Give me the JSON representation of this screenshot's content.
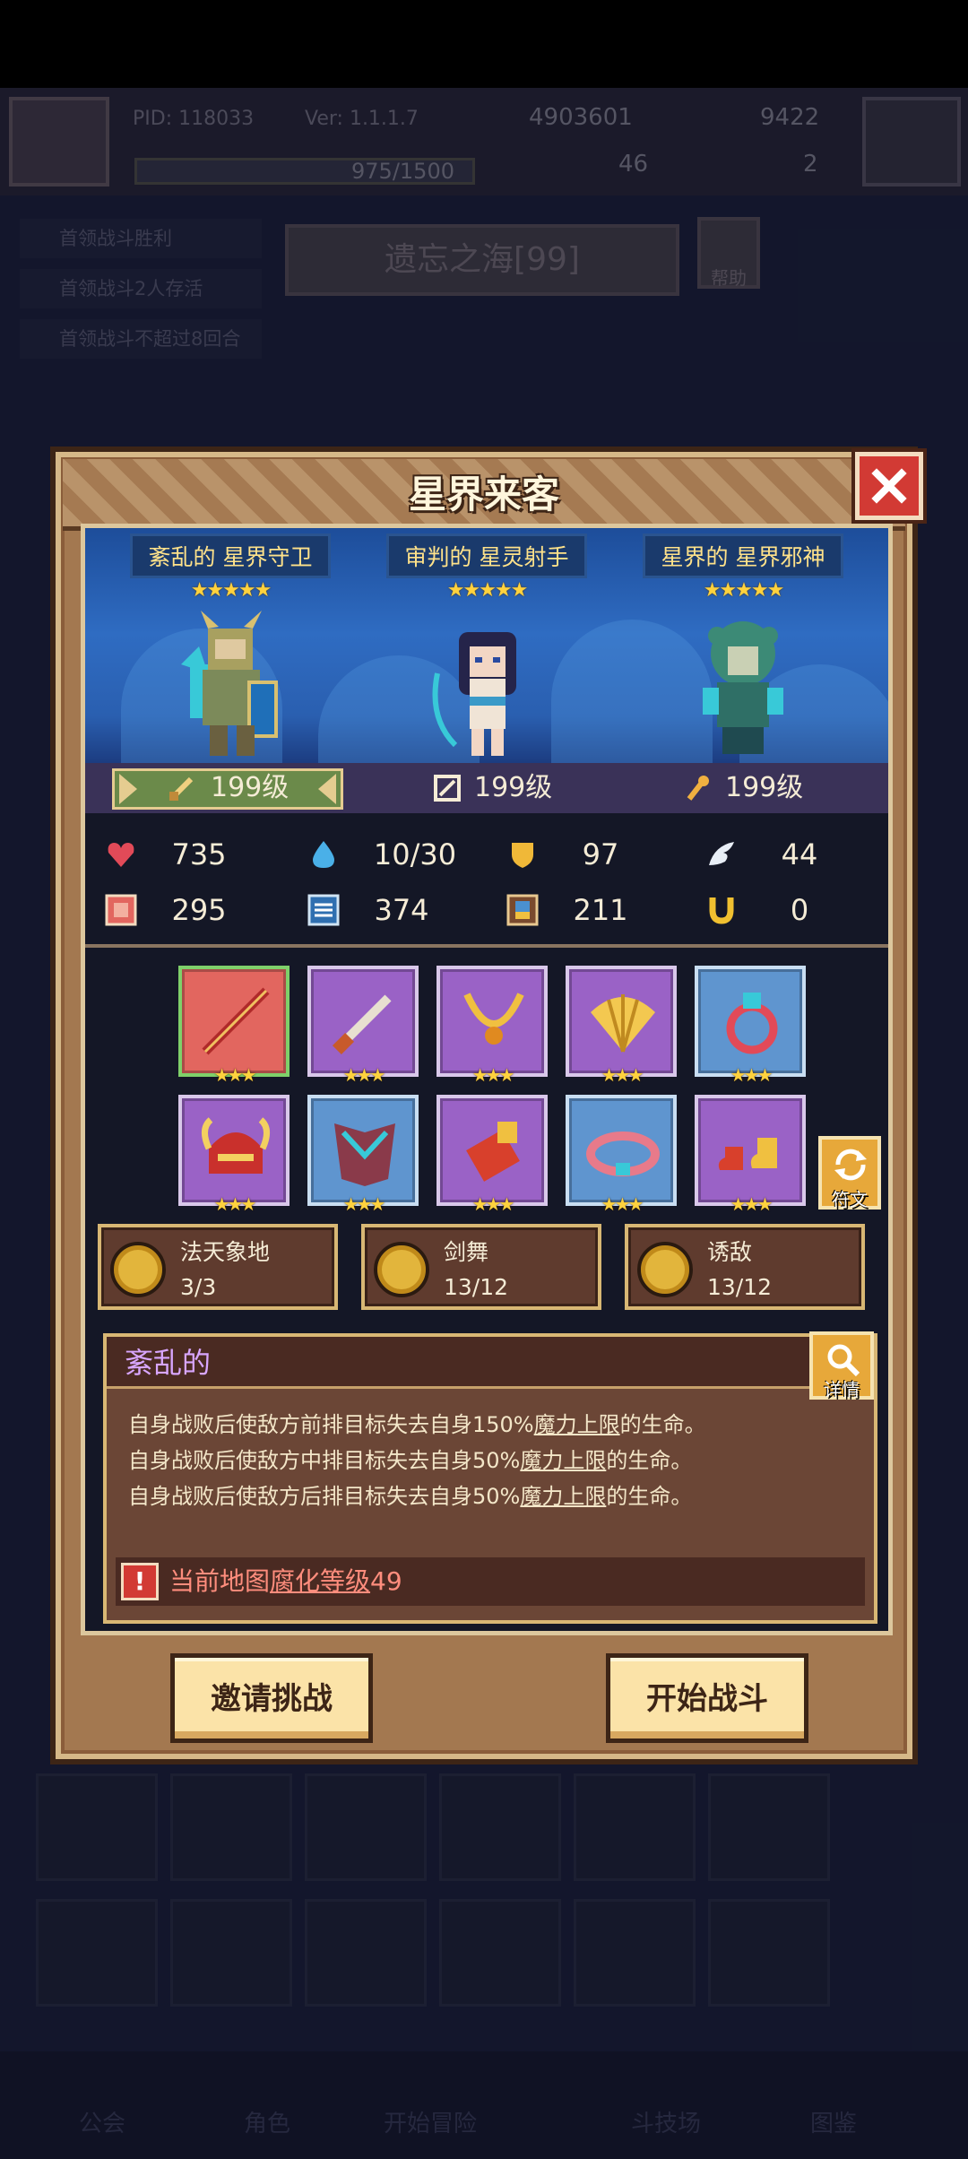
{
  "background": {
    "pid": "PID: 118033",
    "version": "Ver: 1.1.1.7",
    "gold": "4903601",
    "gems": "9422",
    "exp": "975/1500",
    "res2": "46",
    "res3": "2",
    "tasks": [
      "首领战斗胜利",
      "首领战斗2人存活",
      "首领战斗不超过8回合"
    ],
    "map_name": "遗忘之海[99]",
    "help_label": "帮助",
    "nav": [
      "公会",
      "角色",
      "开始冒险",
      "斗技场",
      "图鉴"
    ]
  },
  "dialog": {
    "title": "星界来客",
    "heroes": [
      {
        "name": "紊乱的 星界守卫",
        "stars": "★★★★★",
        "level": "199级"
      },
      {
        "name": "审判的 星灵射手",
        "stars": "★★★★★",
        "level": "199级"
      },
      {
        "name": "星界的 星界邪神",
        "stars": "★★★★★",
        "level": "199级"
      }
    ],
    "stats": {
      "hp": "735",
      "mana": "10/30",
      "defense": "97",
      "speed": "44",
      "attack": "295",
      "magic": "374",
      "resist": "211",
      "luck": "0"
    },
    "equipment_stars": "★★★",
    "rune_label": "符文",
    "skills": [
      {
        "name": "法天象地",
        "level": "3/3"
      },
      {
        "name": "剑舞",
        "level": "13/12"
      },
      {
        "name": "诱敌",
        "level": "13/12"
      }
    ],
    "affix": {
      "title": "紊乱的",
      "detail_label": "详情",
      "lines": [
        {
          "pre": "自身战败后使敌方前排目标失去自身150%",
          "u": "魔力上限",
          "post": "的生命。"
        },
        {
          "pre": "自身战败后使敌方中排目标失去自身50%",
          "u": "魔力上限",
          "post": "的生命。"
        },
        {
          "pre": "自身战败后使敌方后排目标失去自身50%",
          "u": "魔力上限",
          "post": "的生命。"
        }
      ],
      "warning_pre": "当前地图",
      "warning_u": "腐化等级",
      "warning_post": "49"
    },
    "invite_label": "邀请挑战",
    "start_label": "开始战斗"
  },
  "colors": {
    "accent_purple": "#d8a6ff",
    "warning": "#ff8d7d",
    "star": "#ffd23e"
  }
}
